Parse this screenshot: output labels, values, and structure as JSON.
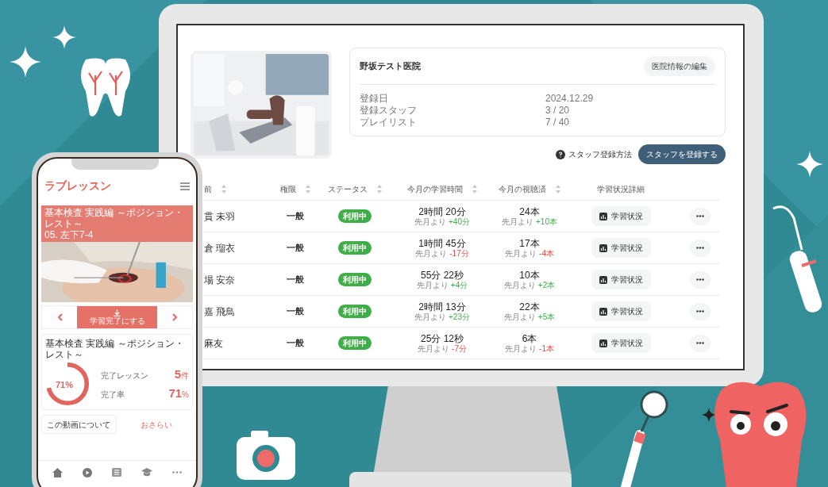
{
  "monitor": {
    "clinic": {
      "name": "野坂テスト医院",
      "edit_button": "医院情報の編集",
      "fields": [
        {
          "label": "登録日",
          "value": "2024.12.29"
        },
        {
          "label": "登録スタッフ",
          "value": "3 / 20"
        },
        {
          "label": "プレイリスト",
          "value": "7 / 40"
        }
      ]
    },
    "help_link": "スタッフ登録方法",
    "register_button": "スタッフを登録する",
    "table": {
      "columns": [
        {
          "label": "前",
          "sortable": true
        },
        {
          "label": "権限",
          "sortable": true
        },
        {
          "label": "ステータス",
          "sortable": true
        },
        {
          "label": "今月の学習時間",
          "sortable": true
        },
        {
          "label": "今月の視聴済",
          "sortable": true
        },
        {
          "label": "学習状況詳細",
          "sortable": false
        }
      ],
      "rows": [
        {
          "name": "貫 未羽",
          "role": "一般",
          "status": "利用中",
          "time": "2時間 20分",
          "time_prefix": "先月より",
          "time_diff": "+40分",
          "time_up": true,
          "views": "24本",
          "views_prefix": "先月より",
          "views_diff": "+10本",
          "views_up": true,
          "detail": "学習状況"
        },
        {
          "name": "倉 瑠衣",
          "role": "一般",
          "status": "利用中",
          "time": "1時間 45分",
          "time_prefix": "先月より",
          "time_diff": "-17分",
          "time_up": false,
          "views": "17本",
          "views_prefix": "先月より",
          "views_diff": "-4本",
          "views_up": false,
          "detail": "学習状況"
        },
        {
          "name": "場 安奈",
          "role": "一般",
          "status": "利用中",
          "time": "55分 22秒",
          "time_prefix": "先月より",
          "time_diff": "+4分",
          "time_up": true,
          "views": "10本",
          "views_prefix": "先月より",
          "views_diff": "+2本",
          "views_up": true,
          "detail": "学習状況"
        },
        {
          "name": "嘉 飛鳥",
          "role": "一般",
          "status": "利用中",
          "time": "2時間 13分",
          "time_prefix": "先月より",
          "time_diff": "+23分",
          "time_up": true,
          "views": "22本",
          "views_prefix": "先月より",
          "views_diff": "+5本",
          "views_up": true,
          "detail": "学習状況"
        },
        {
          "name": "麻友",
          "role": "一般",
          "status": "利用中",
          "time": "25分 12秒",
          "time_prefix": "先月より",
          "time_diff": "-7分",
          "time_up": false,
          "views": "6本",
          "views_prefix": "先月より",
          "views_diff": "-1本",
          "views_up": false,
          "detail": "学習状況"
        }
      ]
    }
  },
  "phone": {
    "app_title": "ラブレッスン",
    "banner": {
      "subtitle": "基本検査 実践編 ～ポジション・レスト～",
      "title": "05. 左下7-4"
    },
    "complete_button": "学習完了にする",
    "progress": {
      "title": "基本検査 実践編 ～ポジション・レスト～",
      "percent": "71%",
      "level": 0.71,
      "stats": [
        {
          "label": "完了レッスン",
          "value": "5",
          "unit": "件"
        },
        {
          "label": "完了率",
          "value": "71",
          "unit": "%"
        }
      ]
    },
    "tabs": [
      {
        "label": "この動画について",
        "selected": false
      },
      {
        "label": "おさらい",
        "selected": true
      }
    ]
  }
}
